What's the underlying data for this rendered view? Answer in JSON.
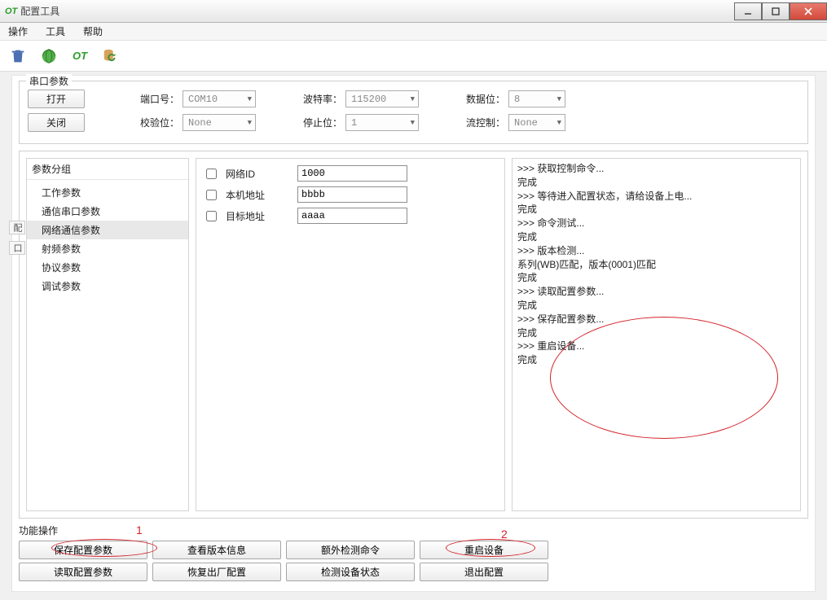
{
  "window": {
    "title": "配置工具"
  },
  "menu": {
    "op": "操作",
    "tool": "工具",
    "help": "帮助"
  },
  "serial": {
    "legend": "串口参数",
    "open": "打开",
    "close": "关闭",
    "port_label": "端口号：",
    "port": "COM10",
    "baud_label": "波特率：",
    "baud": "115200",
    "databits_label": "数据位：",
    "databits": "8",
    "parity_label": "校验位：",
    "parity": "None",
    "stop_label": "停止位：",
    "stop": "1",
    "flow_label": "流控制：",
    "flow": "None"
  },
  "tree": {
    "header": "参数分组",
    "items": [
      "工作参数",
      "通信串口参数",
      "网络通信参数",
      "射频参数",
      "协议参数",
      "调试参数"
    ],
    "selected_index": 2
  },
  "form": {
    "rows": [
      {
        "label": "网络ID",
        "value": "1000"
      },
      {
        "label": "本机地址",
        "value": "bbbb"
      },
      {
        "label": "目标地址",
        "value": "aaaa"
      }
    ]
  },
  "log": ">>> 获取控制命令...\n完成\n>>> 等待进入配置状态，请给设备上电...\n完成\n>>> 命令测试...\n完成\n>>> 版本检测...\n系列(WB)匹配，版本(0001)匹配\n完成\n>>> 读取配置参数...\n完成\n>>> 保存配置参数...\n完成\n>>> 重启设备...\n完成",
  "funcs": {
    "legend": "功能操作",
    "row1": [
      "保存配置参数",
      "查看版本信息",
      "额外检测命令",
      "重启设备"
    ],
    "row2": [
      "读取配置参数",
      "恢复出厂配置",
      "检测设备状态",
      "退出配置"
    ]
  },
  "anno": {
    "n1": "1",
    "n2": "2"
  }
}
